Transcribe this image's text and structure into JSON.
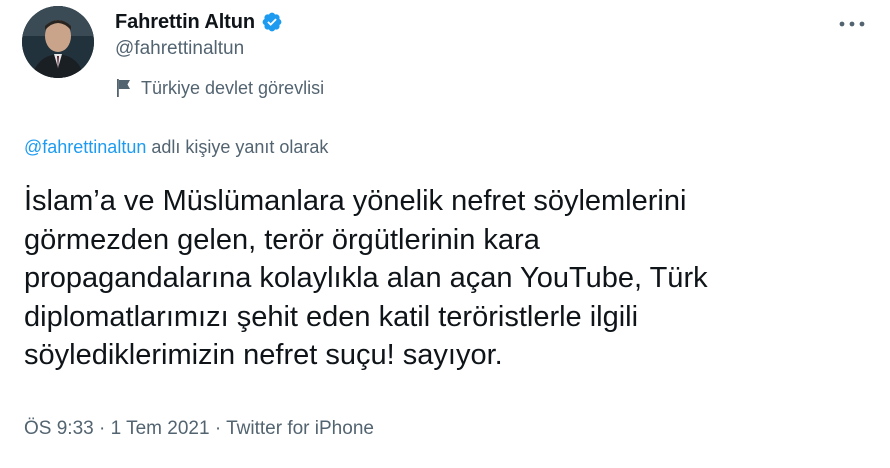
{
  "author": {
    "display_name": "Fahrettin Altun",
    "handle": "@fahrettinaltun",
    "account_label": "Türkiye devlet görevlisi",
    "verified": true
  },
  "icons": {
    "verified": "verified-badge-icon",
    "label": "flag-icon",
    "more": "more-dots-icon"
  },
  "reply": {
    "handle": "@fahrettinaltun",
    "suffix": " adlı kişiye yanıt olarak"
  },
  "tweet": {
    "text": "İslam’a ve Müslümanlara yönelik nefret söylemlerini\ngörmezden gelen, terör örgütlerinin kara\npropagandalarına kolaylıkla alan açan YouTube, Türk\ndiplomatlarımızı şehit eden katil teröristlerle ilgili\nsöylediklerimizin nefret suçu! sayıyor."
  },
  "meta": {
    "time": "ÖS 9:33",
    "date": "1 Tem 2021",
    "source": "Twitter for iPhone",
    "separator": "·"
  },
  "colors": {
    "accent": "#1d9bf0",
    "secondary_text": "#536471",
    "primary_text": "#0f1419"
  }
}
